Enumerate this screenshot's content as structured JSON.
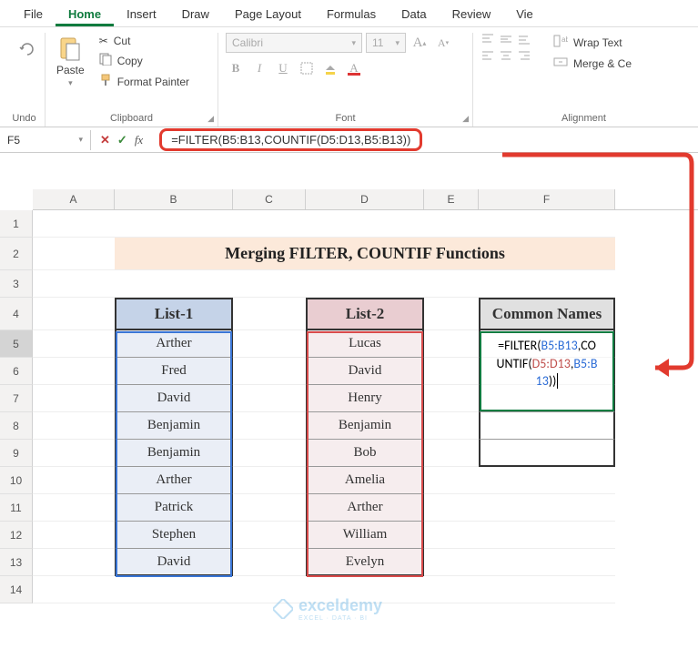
{
  "tabs": [
    "File",
    "Home",
    "Insert",
    "Draw",
    "Page Layout",
    "Formulas",
    "Data",
    "Review",
    "Vie"
  ],
  "active_tab": "Home",
  "ribbon": {
    "undo_label": "Undo",
    "clipboard_label": "Clipboard",
    "font_label": "Font",
    "alignment_label": "Alignment",
    "paste_label": "Paste",
    "cut_label": "Cut",
    "copy_label": "Copy",
    "fmt_painter_label": "Format Painter",
    "font_name": "Calibri",
    "font_size": "11",
    "wrap_label": "Wrap Text",
    "merge_label": "Merge & Ce"
  },
  "namebox": "F5",
  "formula": "=FILTER(B5:B13,COUNTIF(D5:D13,B5:B13))",
  "cell_formula_parts": {
    "p1": "=FILTER(",
    "p2": "B5:B13",
    "p3": ",CO",
    "p4": "UNTIF(",
    "p5": "D5:D13",
    "p6": ",",
    "p7": "B5:B",
    "p8": "13",
    "p9": "))"
  },
  "columns": [
    "A",
    "B",
    "C",
    "D",
    "E",
    "F"
  ],
  "rows": [
    "1",
    "2",
    "3",
    "4",
    "5",
    "6",
    "7",
    "8",
    "9",
    "10",
    "11",
    "12",
    "13",
    "14"
  ],
  "title": "Merging FILTER, COUNTIF Functions",
  "headers": {
    "list1": "List-1",
    "list2": "List-2",
    "common": "Common Names"
  },
  "list1": [
    "Arther",
    "Fred",
    "David",
    "Benjamin",
    "Benjamin",
    "Arther",
    "Patrick",
    "Stephen",
    "David"
  ],
  "list2": [
    "Lucas",
    "David",
    "Henry",
    "Benjamin",
    "Bob",
    "Amelia",
    "Arther",
    "William",
    "Evelyn"
  ],
  "watermark": {
    "brand": "exceldemy",
    "tag": "EXCEL · DATA · BI"
  }
}
